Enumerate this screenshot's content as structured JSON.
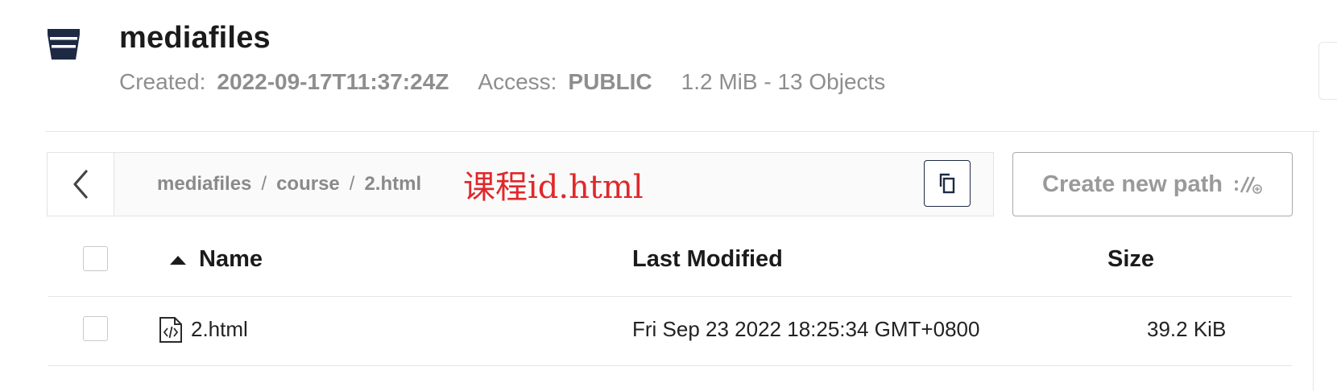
{
  "bucket": {
    "name": "mediafiles",
    "icon": "bucket-icon",
    "created_label": "Created:",
    "created_value": "2022-09-17T11:37:24Z",
    "access_label": "Access:",
    "access_value": "PUBLIC",
    "usage": "1.2 MiB - 13 Objects"
  },
  "pathbar": {
    "back_icon": "chevron-left-icon",
    "breadcrumb": [
      "mediafiles",
      "course",
      "2.html"
    ],
    "separator": "/",
    "annotation": "课程id.html",
    "copy_icon": "copy-icon"
  },
  "create_path": {
    "label": "Create new path",
    "icon": "new-path-icon"
  },
  "table": {
    "columns": [
      "Name",
      "Last Modified",
      "Size"
    ],
    "sort": {
      "column": "Name",
      "direction": "ascending"
    },
    "rows": [
      {
        "name": "2.html",
        "icon": "html-file-icon",
        "last_modified": "Fri Sep 23 2022 18:25:34 GMT+0800",
        "size": "39.2 KiB"
      }
    ]
  },
  "colors": {
    "primary_dark": "#1e2a44",
    "muted_text": "#8e8e8e",
    "annotation_red": "#e0282b",
    "border": "#e3e3e3"
  }
}
